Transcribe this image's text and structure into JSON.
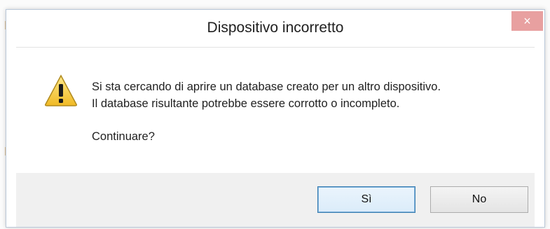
{
  "dialog": {
    "title": "Dispositivo incorretto",
    "close_label": "×",
    "message_lines": [
      "Si sta cercando di aprire un database creato per un altro dispositivo.",
      "Il database risultante potrebbe essere corrotto o incompleto."
    ],
    "question": "Continuare?",
    "yes_label": "Sì",
    "no_label": "No",
    "icon": "warning-icon"
  },
  "colors": {
    "close_button": "#e8a0a0",
    "footer_background": "#f0f0f0",
    "default_button_border": "#3c7fb1"
  }
}
